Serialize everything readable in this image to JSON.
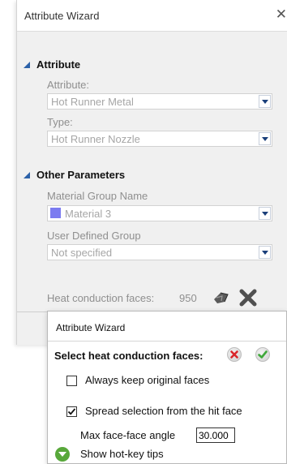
{
  "wizard": {
    "title": "Attribute Wizard",
    "close_symbol": "✕",
    "sections": {
      "attribute": {
        "heading": "Attribute",
        "attribute_label": "Attribute:",
        "attribute_value": "Hot Runner Metal",
        "type_label": "Type:",
        "type_value": "Hot Runner Nozzle"
      },
      "other": {
        "heading": "Other Parameters",
        "material_group_label": "Material Group Name",
        "material_group_value": "Material 3",
        "material_color": "#7b7bf0",
        "user_group_label": "User Defined Group",
        "user_group_value": "Not specified",
        "heat_label": "Heat conduction faces:",
        "heat_count": "950"
      }
    },
    "icons": [
      "triangle-expanded-icon",
      "select-faces-icon",
      "clear-icon",
      "dropdown-arrow-icon"
    ]
  },
  "popup": {
    "title": "Attribute Wizard",
    "heading": "Select heat conduction faces:",
    "keep_original_label": "Always keep original faces",
    "keep_original_checked": false,
    "spread_label": "Spread selection from the hit face",
    "spread_checked": true,
    "angle_label": "Max face-face angle",
    "angle_value": "30.000",
    "hotkey_label": "Show hot-key tips",
    "colors": {
      "cancel": "#d9262b",
      "confirm": "#3fa83a",
      "tips": "#58a83a"
    }
  },
  "accent_color": "#2c61a8"
}
